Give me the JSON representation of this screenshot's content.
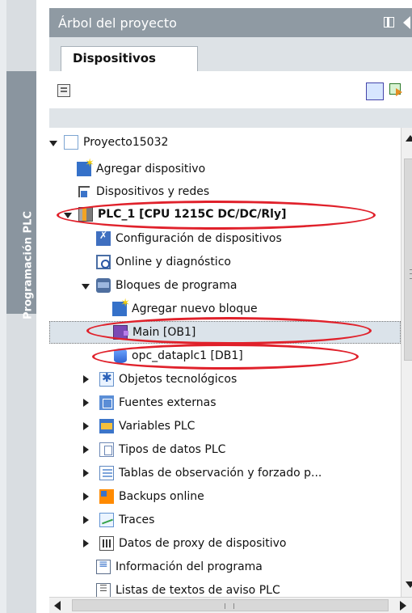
{
  "sidebar": {
    "vertical_label": "Programación PLC"
  },
  "panel": {
    "title": "Árbol del proyecto"
  },
  "tabs": {
    "devices": "Dispositivos"
  },
  "tree": {
    "items": [
      {
        "label": "Proyecto15032",
        "icon": "project-icon",
        "expanded": true
      },
      {
        "label": "Agregar dispositivo",
        "icon": "add-device-icon"
      },
      {
        "label": "Dispositivos y redes",
        "icon": "network-icon"
      },
      {
        "label": "PLC_1 [CPU 1215C DC/DC/Rly]",
        "icon": "plc-icon",
        "expanded": true
      },
      {
        "label": "Configuración de dispositivos",
        "icon": "device-config-icon"
      },
      {
        "label": "Online y diagnóstico",
        "icon": "online-diagnostics-icon"
      },
      {
        "label": "Bloques de programa",
        "icon": "program-blocks-icon",
        "expanded": true
      },
      {
        "label": "Agregar nuevo bloque",
        "icon": "add-block-icon"
      },
      {
        "label": "Main [OB1]",
        "icon": "main-ob-icon",
        "selected": true
      },
      {
        "label": "opc_dataplc1 [DB1]",
        "icon": "data-block-icon"
      },
      {
        "label": "Objetos tecnológicos",
        "icon": "technology-objects-icon"
      },
      {
        "label": "Fuentes externas",
        "icon": "external-sources-icon"
      },
      {
        "label": "Variables PLC",
        "icon": "plc-tags-icon"
      },
      {
        "label": "Tipos de datos PLC",
        "icon": "plc-data-types-icon"
      },
      {
        "label": "Tablas de observación y forzado p...",
        "icon": "watch-tables-icon"
      },
      {
        "label": "Backups online",
        "icon": "online-backups-icon"
      },
      {
        "label": "Traces",
        "icon": "traces-icon"
      },
      {
        "label": "Datos de proxy de dispositivo",
        "icon": "device-proxy-data-icon"
      },
      {
        "label": "Información del programa",
        "icon": "program-info-icon"
      },
      {
        "label": "Listas de textos de aviso PLC",
        "icon": "plc-message-text-lists-icon"
      }
    ]
  },
  "colors": {
    "highlight_ellipse": "#e0212b",
    "panel_header": "#8f9aa3",
    "left_tab": "#8a959f"
  }
}
